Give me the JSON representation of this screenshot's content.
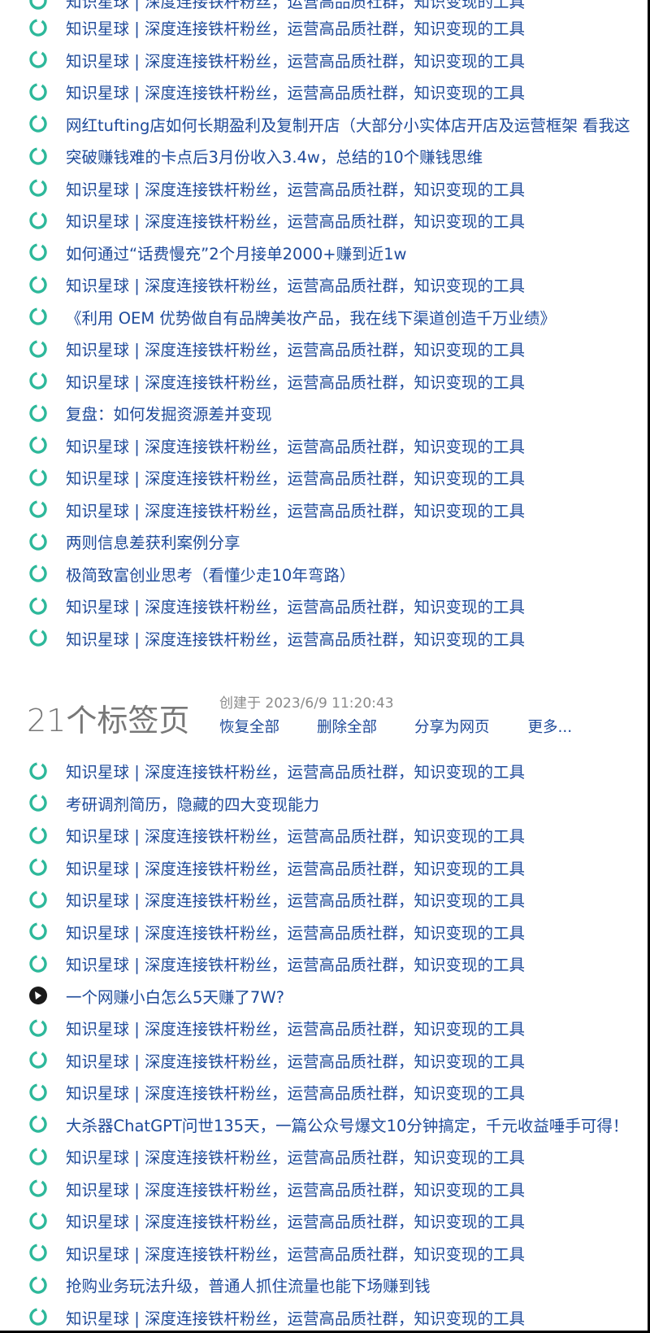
{
  "colors": {
    "link": "#1e4a9a",
    "icon_ring": "#2db89a",
    "muted": "#8a8a8a",
    "count": "#777777"
  },
  "partial_top_row": {
    "title": "知识星球 | 深度连接铁杆粉丝，运营高品质社群，知识变现的工具",
    "icon": "loading-ring-icon"
  },
  "group1": {
    "tabs": [
      {
        "title": "知识星球 | 深度连接铁杆粉丝，运营高品质社群，知识变现的工具",
        "icon": "loading-ring-icon"
      },
      {
        "title": "知识星球 | 深度连接铁杆粉丝，运营高品质社群，知识变现的工具",
        "icon": "loading-ring-icon"
      },
      {
        "title": "知识星球 | 深度连接铁杆粉丝，运营高品质社群，知识变现的工具",
        "icon": "loading-ring-icon"
      },
      {
        "title": "网红tufting店如何长期盈利及复制开店（大部分小实体店开店及运营框架 看我这",
        "icon": "loading-ring-icon"
      },
      {
        "title": "突破赚钱难的卡点后3月份收入3.4w，总结的10个赚钱思维",
        "icon": "loading-ring-icon"
      },
      {
        "title": "知识星球 | 深度连接铁杆粉丝，运营高品质社群，知识变现的工具",
        "icon": "loading-ring-icon"
      },
      {
        "title": "知识星球 | 深度连接铁杆粉丝，运营高品质社群，知识变现的工具",
        "icon": "loading-ring-icon"
      },
      {
        "title": "如何通过“话费慢充”2个月接单2000+赚到近1w",
        "icon": "loading-ring-icon"
      },
      {
        "title": "知识星球 | 深度连接铁杆粉丝，运营高品质社群，知识变现的工具",
        "icon": "loading-ring-icon"
      },
      {
        "title": "《利用 OEM 优势做自有品牌美妆产品，我在线下渠道创造千万业绩》",
        "icon": "loading-ring-icon"
      },
      {
        "title": "知识星球 | 深度连接铁杆粉丝，运营高品质社群，知识变现的工具",
        "icon": "loading-ring-icon"
      },
      {
        "title": "知识星球 | 深度连接铁杆粉丝，运营高品质社群，知识变现的工具",
        "icon": "loading-ring-icon"
      },
      {
        "title": "复盘：如何发掘资源差并变现",
        "icon": "loading-ring-icon"
      },
      {
        "title": "知识星球 | 深度连接铁杆粉丝，运营高品质社群，知识变现的工具",
        "icon": "loading-ring-icon"
      },
      {
        "title": "知识星球 | 深度连接铁杆粉丝，运营高品质社群，知识变现的工具",
        "icon": "loading-ring-icon"
      },
      {
        "title": "知识星球 | 深度连接铁杆粉丝，运营高品质社群，知识变现的工具",
        "icon": "loading-ring-icon"
      },
      {
        "title": "两则信息差获利案例分享",
        "icon": "loading-ring-icon"
      },
      {
        "title": "极简致富创业思考（看懂少走10年弯路）",
        "icon": "loading-ring-icon"
      },
      {
        "title": "知识星球 | 深度连接铁杆粉丝，运营高品质社群，知识变现的工具",
        "icon": "loading-ring-icon"
      },
      {
        "title": "知识星球 | 深度连接铁杆粉丝，运营高品质社群，知识变现的工具",
        "icon": "loading-ring-icon"
      }
    ]
  },
  "group2": {
    "count_label": "21个标签页",
    "created_label": "创建于 2023/6/9 11:20:43",
    "actions": {
      "restore_all": "恢复全部",
      "delete_all": "删除全部",
      "share_web": "分享为网页",
      "more": "更多..."
    },
    "tabs": [
      {
        "title": "知识星球 | 深度连接铁杆粉丝，运营高品质社群，知识变现的工具",
        "icon": "loading-ring-icon"
      },
      {
        "title": "考研调剂简历，隐藏的四大变现能力",
        "icon": "loading-ring-icon"
      },
      {
        "title": "知识星球 | 深度连接铁杆粉丝，运营高品质社群，知识变现的工具",
        "icon": "loading-ring-icon"
      },
      {
        "title": "知识星球 | 深度连接铁杆粉丝，运营高品质社群，知识变现的工具",
        "icon": "loading-ring-icon"
      },
      {
        "title": "知识星球 | 深度连接铁杆粉丝，运营高品质社群，知识变现的工具",
        "icon": "loading-ring-icon"
      },
      {
        "title": "知识星球 | 深度连接铁杆粉丝，运营高品质社群，知识变现的工具",
        "icon": "loading-ring-icon"
      },
      {
        "title": "知识星球 | 深度连接铁杆粉丝，运营高品质社群，知识变现的工具",
        "icon": "loading-ring-icon"
      },
      {
        "title": "一个网赚小白怎么5天赚了7W?",
        "icon": "dark-circle-favicon-icon"
      },
      {
        "title": "知识星球 | 深度连接铁杆粉丝，运营高品质社群，知识变现的工具",
        "icon": "loading-ring-icon"
      },
      {
        "title": "知识星球 | 深度连接铁杆粉丝，运营高品质社群，知识变现的工具",
        "icon": "loading-ring-icon"
      },
      {
        "title": "知识星球 | 深度连接铁杆粉丝，运营高品质社群，知识变现的工具",
        "icon": "loading-ring-icon"
      },
      {
        "title": "大杀器ChatGPT问世135天，一篇公众号爆文10分钟搞定，千元收益唾手可得！",
        "icon": "loading-ring-icon"
      },
      {
        "title": "知识星球 | 深度连接铁杆粉丝，运营高品质社群，知识变现的工具",
        "icon": "loading-ring-icon"
      },
      {
        "title": "知识星球 | 深度连接铁杆粉丝，运营高品质社群，知识变现的工具",
        "icon": "loading-ring-icon"
      },
      {
        "title": "知识星球 | 深度连接铁杆粉丝，运营高品质社群，知识变现的工具",
        "icon": "loading-ring-icon"
      },
      {
        "title": "知识星球 | 深度连接铁杆粉丝，运营高品质社群，知识变现的工具",
        "icon": "loading-ring-icon"
      },
      {
        "title": "抢购业务玩法升级，普通人抓住流量也能下场赚到钱",
        "icon": "loading-ring-icon"
      },
      {
        "title": "知识星球 | 深度连接铁杆粉丝，运营高品质社群，知识变现的工具",
        "icon": "loading-ring-icon"
      }
    ]
  }
}
